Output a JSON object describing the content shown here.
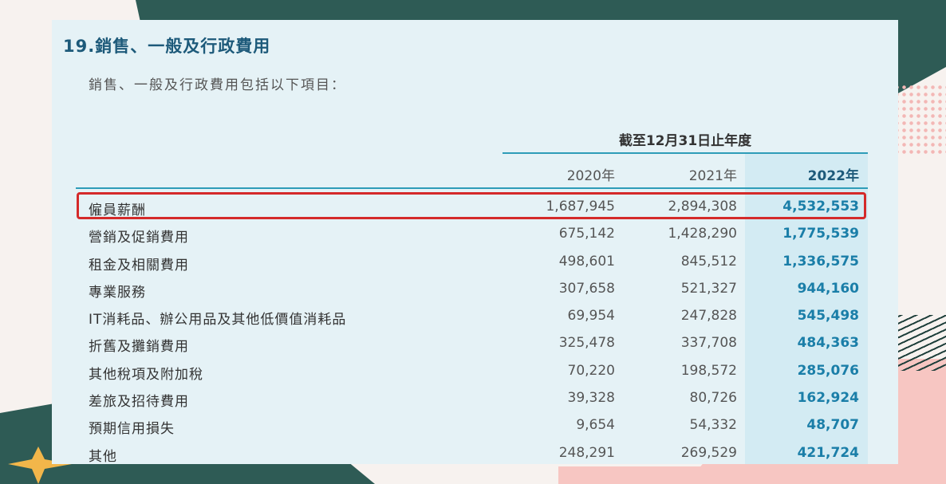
{
  "note": {
    "title": "19.銷售、一般及行政費用",
    "intro": "銷售、一般及行政費用包括以下項目：",
    "period_header": "截至12月31日止年度",
    "columns": [
      "2020年",
      "2021年",
      "2022年"
    ],
    "highlighted_row": "僱員薪酬"
  },
  "rows": [
    {
      "label": "僱員薪酬",
      "v2020": "1,687,945",
      "v2021": "2,894,308",
      "v2022": "4,532,553"
    },
    {
      "label": "營銷及促銷費用",
      "v2020": "675,142",
      "v2021": "1,428,290",
      "v2022": "1,775,539"
    },
    {
      "label": "租金及相關費用",
      "v2020": "498,601",
      "v2021": "845,512",
      "v2022": "1,336,575"
    },
    {
      "label": "專業服務",
      "v2020": "307,658",
      "v2021": "521,327",
      "v2022": "944,160"
    },
    {
      "label": "IT消耗品、辦公用品及其他低價值消耗品",
      "v2020": "69,954",
      "v2021": "247,828",
      "v2022": "545,498"
    },
    {
      "label": "折舊及攤銷費用",
      "v2020": "325,478",
      "v2021": "337,708",
      "v2022": "484,363"
    },
    {
      "label": "其他稅項及附加稅",
      "v2020": "70,220",
      "v2021": "198,572",
      "v2022": "285,076"
    },
    {
      "label": "差旅及招待費用",
      "v2020": "39,328",
      "v2021": "80,726",
      "v2022": "162,924"
    },
    {
      "label": "預期信用損失",
      "v2020": "9,654",
      "v2021": "54,332",
      "v2022": "48,707"
    },
    {
      "label": "其他",
      "v2020": "248,291",
      "v2021": "269,529",
      "v2022": "421,724"
    }
  ],
  "colors": {
    "title": "#1d5a7a",
    "accent_2022": "#1a7ea8",
    "rule": "#2e9cb8",
    "highlight_border": "#d42a2a",
    "doc_bg": "#e5f2f6"
  }
}
